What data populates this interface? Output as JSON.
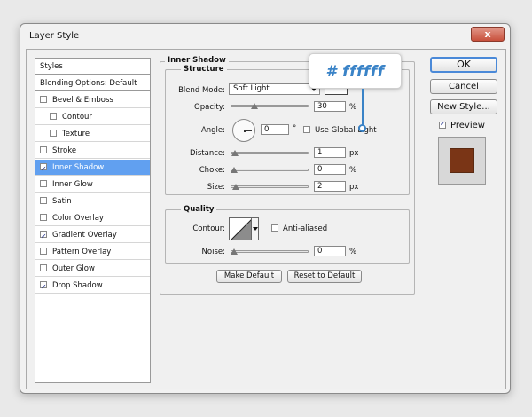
{
  "window": {
    "title": "Layer Style",
    "close_label": "x"
  },
  "tooltip": {
    "text": "# ffffff"
  },
  "sidebar": {
    "items": [
      {
        "label": "Styles",
        "checkbox": false,
        "checked": false,
        "selected": false
      },
      {
        "label": "Blending Options: Default",
        "checkbox": false,
        "checked": false,
        "selected": false
      },
      {
        "label": "Bevel & Emboss",
        "checkbox": true,
        "checked": false,
        "selected": false
      },
      {
        "label": "Contour",
        "checkbox": true,
        "checked": false,
        "selected": false
      },
      {
        "label": "Texture",
        "checkbox": true,
        "checked": false,
        "selected": false
      },
      {
        "label": "Stroke",
        "checkbox": true,
        "checked": false,
        "selected": false
      },
      {
        "label": "Inner Shadow",
        "checkbox": true,
        "checked": true,
        "selected": true
      },
      {
        "label": "Inner Glow",
        "checkbox": true,
        "checked": false,
        "selected": false
      },
      {
        "label": "Satin",
        "checkbox": true,
        "checked": false,
        "selected": false
      },
      {
        "label": "Color Overlay",
        "checkbox": true,
        "checked": false,
        "selected": false
      },
      {
        "label": "Gradient Overlay",
        "checkbox": true,
        "checked": true,
        "selected": false
      },
      {
        "label": "Pattern Overlay",
        "checkbox": true,
        "checked": false,
        "selected": false
      },
      {
        "label": "Outer Glow",
        "checkbox": true,
        "checked": false,
        "selected": false
      },
      {
        "label": "Drop Shadow",
        "checkbox": true,
        "checked": true,
        "selected": false
      }
    ]
  },
  "inner_shadow": {
    "title": "Inner Shadow",
    "structure": {
      "title": "Structure",
      "blend_mode_label": "Blend Mode:",
      "blend_mode_value": "Soft Light",
      "shadow_color": "#ffffff",
      "opacity_label": "Opacity:",
      "opacity_value": "30",
      "opacity_unit": "%",
      "opacity_pct": 30,
      "angle_label": "Angle:",
      "angle_value": "0",
      "angle_unit": "°",
      "use_global_light_label": "Use Global Light",
      "use_global_light": false,
      "distance_label": "Distance:",
      "distance_value": "1",
      "distance_unit": "px",
      "distance_pct": 1,
      "choke_label": "Choke:",
      "choke_value": "0",
      "choke_unit": "%",
      "choke_pct": 0,
      "size_label": "Size:",
      "size_value": "2",
      "size_unit": "px",
      "size_pct": 2
    },
    "quality": {
      "title": "Quality",
      "contour_label": "Contour:",
      "anti_aliased_label": "Anti-aliased",
      "anti_aliased": false,
      "noise_label": "Noise:",
      "noise_value": "0",
      "noise_unit": "%",
      "noise_pct": 0
    },
    "make_default_label": "Make Default",
    "reset_default_label": "Reset to Default"
  },
  "buttons": {
    "ok_label": "OK",
    "cancel_label": "Cancel",
    "new_style_label": "New Style...",
    "preview_label": "Preview",
    "preview_checked": true
  },
  "colors": {
    "accent": "#61a0f0",
    "preview_fill": "#7a3516",
    "tooltip": "#3a83c7"
  }
}
